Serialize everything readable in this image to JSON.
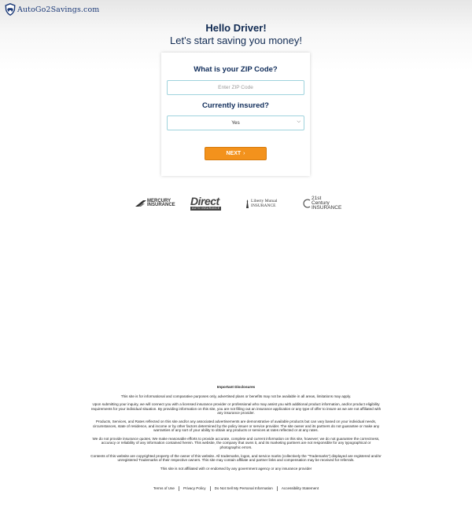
{
  "brand": {
    "name": "AutoGo2Savings.com",
    "logo_icon": "shield-car-icon",
    "color": "#1c3a78"
  },
  "hero": {
    "title": "Hello Driver!",
    "subtitle": "Let's start saving you money!"
  },
  "form": {
    "zip_question": "What is your ZIP Code?",
    "zip_placeholder": "Enter ZIP Code",
    "zip_value": "",
    "insured_question": "Currently insured?",
    "insured_selected": "Yes",
    "next_label": "NEXT",
    "next_arrow": "›",
    "accent": "#f3921c"
  },
  "partners": {
    "mercury": "MERCURY INSURANCE",
    "direct_main": "Direct",
    "direct_sub": "AUTO INSURANCE",
    "liberty": "Liberty Mutual INSURANCE",
    "century": "21st Century INSURANCE"
  },
  "disclosures": {
    "title": "Important Disclosures",
    "paragraphs": [
      "This site is for informational and comparative purposes only, advertised plans or benefits may not be available in all areas, limitations may apply.",
      "Upon submitting your inquiry, we will connect you with a licensed insurance provider or professional who may assist you with additional product information, and/or product eligibility requirements for your individual situation. By providing information on this site, you are not filling out an insurance application or any type of offer to insure as we are not affiliated with any insurance provider.",
      "Products, Services, and Rates reflected on this site and/or any associated advertisements are demonstrative of available products but can vary based on your individual needs, circumstances, state of residence, and income or by other factors determined by the policy issuer or service provider. The site owner and its partners do not guarantee or make any warranties of any sort of your ability to obtain any products or services at rates reflected or at any rates.",
      "We do not provide insurance quotes. We make reasonable efforts to provide accurate, complete and current information on this site, however; we do not guarantee the correctness, accuracy or reliability of any information contained herein. This website, the company that owns it, and its marketing partners are not responsible for any typographical or photographic errors.",
      "Contents of this website are copyrighted property of the owner of this website. All trademarks, logos, and service marks (collectively the \"Trademarks\") displayed are registered and/or unregistered Trademarks of their respective owners. This site may contain affiliate and partner links and compensation may be received for referrals.",
      "This site is not affiliated with or endorsed by any government agency or any insurance provider"
    ]
  },
  "footer": {
    "links": [
      "Terms of Use",
      "Privacy Policy",
      "Do Not Sell My Personal Information",
      "Accessibility Statement"
    ]
  }
}
